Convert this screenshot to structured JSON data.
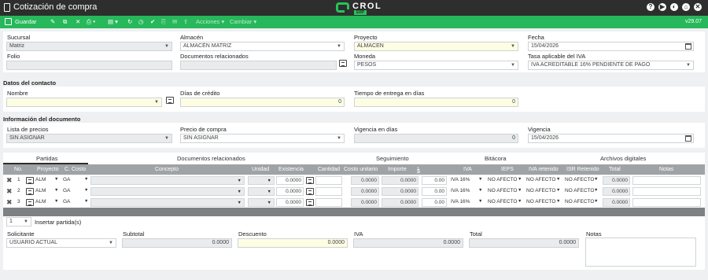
{
  "window": {
    "title": "Cotización de compra"
  },
  "brand": {
    "name": "CROL",
    "sub": "ERP"
  },
  "toolbar": {
    "save_label": "Guardar",
    "actions_label": "Acciones ▾",
    "change_label": "Cambiar ▾",
    "version": "v29.07"
  },
  "header": {
    "sucursal": {
      "label": "Sucursal",
      "value": "Matriz"
    },
    "almacen": {
      "label": "Almacén",
      "value": "ALMACÉN MATRIZ"
    },
    "proyecto": {
      "label": "Proyecto",
      "value": "ALMACEN"
    },
    "fecha": {
      "label": "Fecha",
      "value": "15/04/2026"
    },
    "folio": {
      "label": "Folio",
      "value": ""
    },
    "docs": {
      "label": "Documentos relacionados",
      "value": ""
    },
    "moneda": {
      "label": "Moneda",
      "value": "PESOS"
    },
    "tasa": {
      "label": "Tasa aplicable del IVA",
      "value": "IVA ACREDITABLE 16% PENDIENTE DE PAGO"
    }
  },
  "contact": {
    "section": "Datos del contacto",
    "nombre": {
      "label": "Nombre",
      "value": ""
    },
    "dias_credito": {
      "label": "Días de crédito",
      "value": "0"
    },
    "tiempo_entrega": {
      "label": "Tiempo de entrega en días",
      "value": "0"
    }
  },
  "docinfo": {
    "section": "Información del documento",
    "lista": {
      "label": "Lista de precios",
      "value": "SIN ASIGNAR"
    },
    "precio": {
      "label": "Precio de compra",
      "value": "SIN ASIGNAR"
    },
    "vigencia_dias": {
      "label": "Vigencia en días",
      "value": "0"
    },
    "vigencia": {
      "label": "Vigencia",
      "value": "15/04/2026"
    }
  },
  "tabs": [
    "Partidas",
    "Documentos relacionados",
    "Seguimiento",
    "Bitácora",
    "Archivos digitales"
  ],
  "grid": {
    "columns": [
      "No.",
      "Proyecto",
      "C. Costo",
      "Concepto",
      "Unidad",
      "Existencia",
      "Cantidad",
      "Costo unitario",
      "Importe",
      "$ Descuento",
      "IVA",
      "IEPS",
      "IVA retenido",
      "ISR Retenido",
      "Total",
      "Notas"
    ],
    "descuento_sup": "1",
    "rows": [
      {
        "no": "1",
        "proyecto": "ALM",
        "costo": "GA",
        "existencia": "0.0000",
        "cantidad": "",
        "costo_unitario": "0.0000",
        "importe": "0.0000",
        "descuento": "0.00",
        "iva": "IVA 16%",
        "ieps": "NO AFECTO",
        "iva_ret": "NO AFECTO",
        "isr_ret": "NO AFECTO",
        "total": "0.0000"
      },
      {
        "no": "2",
        "proyecto": "ALM",
        "costo": "GA",
        "existencia": "0.0000",
        "cantidad": "",
        "costo_unitario": "0.0000",
        "importe": "0.0000",
        "descuento": "0.00",
        "iva": "IVA 16%",
        "ieps": "NO AFECTO",
        "iva_ret": "NO AFECTO",
        "isr_ret": "NO AFECTO",
        "total": "0.0000"
      },
      {
        "no": "3",
        "proyecto": "ALM",
        "costo": "GA",
        "existencia": "0.0000",
        "cantidad": "",
        "costo_unitario": "0.0000",
        "importe": "0.0000",
        "descuento": "0.00",
        "iva": "IVA 16%",
        "ieps": "NO AFECTO",
        "iva_ret": "NO AFECTO",
        "isr_ret": "NO AFECTO",
        "total": "0.0000"
      }
    ]
  },
  "pager": {
    "count": "1",
    "insert_label": "Insertar partida(s)"
  },
  "footer": {
    "solicitante": {
      "label": "Solicitante",
      "value": "USUARIO ACTUAL"
    },
    "subtotal": {
      "label": "Subtotal",
      "value": "0.0000"
    },
    "descuento": {
      "label": "Descuento",
      "value": "0.0000"
    },
    "iva": {
      "label": "IVA",
      "value": "0.0000"
    },
    "total": {
      "label": "Total",
      "value": "0.0000"
    },
    "notas": {
      "label": "Notas",
      "value": ""
    }
  }
}
